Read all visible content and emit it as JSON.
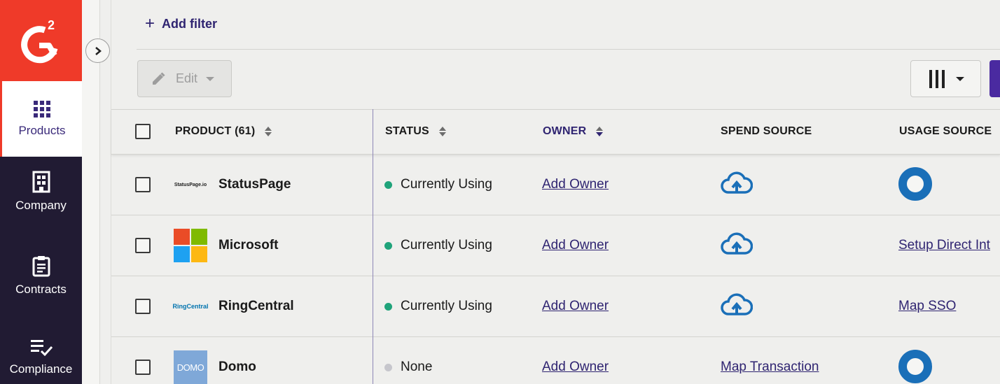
{
  "sidebar": {
    "items": [
      {
        "label": "Products",
        "icon": "grid-icon"
      },
      {
        "label": "Company",
        "icon": "building-icon"
      },
      {
        "label": "Contracts",
        "icon": "clipboard-icon"
      },
      {
        "label": "Compliance",
        "icon": "checklist-icon"
      }
    ]
  },
  "toolbar": {
    "add_filter": "Add filter",
    "edit_label": "Edit"
  },
  "table": {
    "headers": {
      "product": "PRODUCT (61)",
      "status": "STATUS",
      "owner": "OWNER",
      "spend_source": "SPEND SOURCE",
      "usage_source": "USAGE SOURCE"
    },
    "rows": [
      {
        "logo_text": "StatusPage.io",
        "name": "StatusPage",
        "status": "Currently Using",
        "owner": "Add Owner",
        "spend": "cloud-upload-icon",
        "usage": "ring-icon"
      },
      {
        "logo_text": "",
        "name": "Microsoft",
        "status": "Currently Using",
        "owner": "Add Owner",
        "spend": "cloud-upload-icon",
        "usage": "Setup Direct Int"
      },
      {
        "logo_text": "RingCentral",
        "name": "RingCentral",
        "status": "Currently Using",
        "owner": "Add Owner",
        "spend": "cloud-upload-icon",
        "usage": "Map SSO"
      },
      {
        "logo_text": "DOMO",
        "name": "Domo",
        "status": "None",
        "owner": "Add Owner",
        "spend": "Map Transaction",
        "usage": "ring-icon"
      }
    ]
  },
  "colors": {
    "brand": "#ef3a29",
    "sidebar": "#211b33",
    "accent": "#2f2471",
    "status_active": "#1fa37a",
    "status_none": "#c6c6cc",
    "cloud": "#1a6fb8"
  }
}
